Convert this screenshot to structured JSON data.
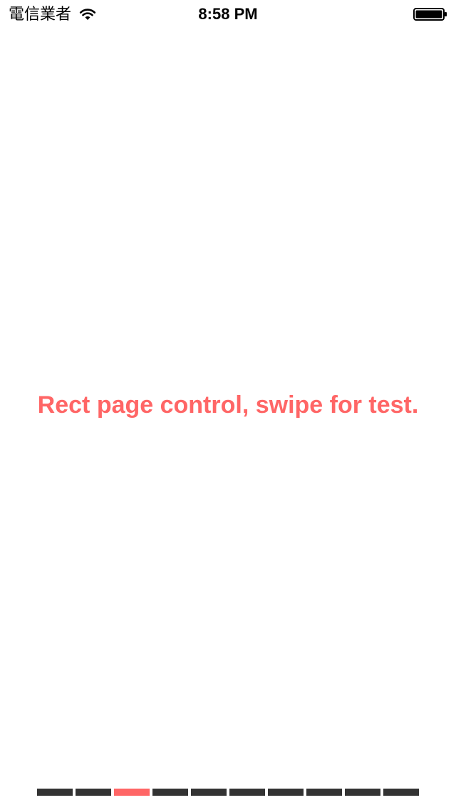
{
  "status_bar": {
    "carrier": "電信業者",
    "time": "8:58 PM",
    "wifi_icon": "wifi-icon",
    "battery_icon": "battery-icon"
  },
  "main": {
    "label": "Rect page control, swipe for test."
  },
  "page_control": {
    "count": 10,
    "current_index": 2,
    "active_color": "#ff6666",
    "inactive_color": "#333333"
  }
}
